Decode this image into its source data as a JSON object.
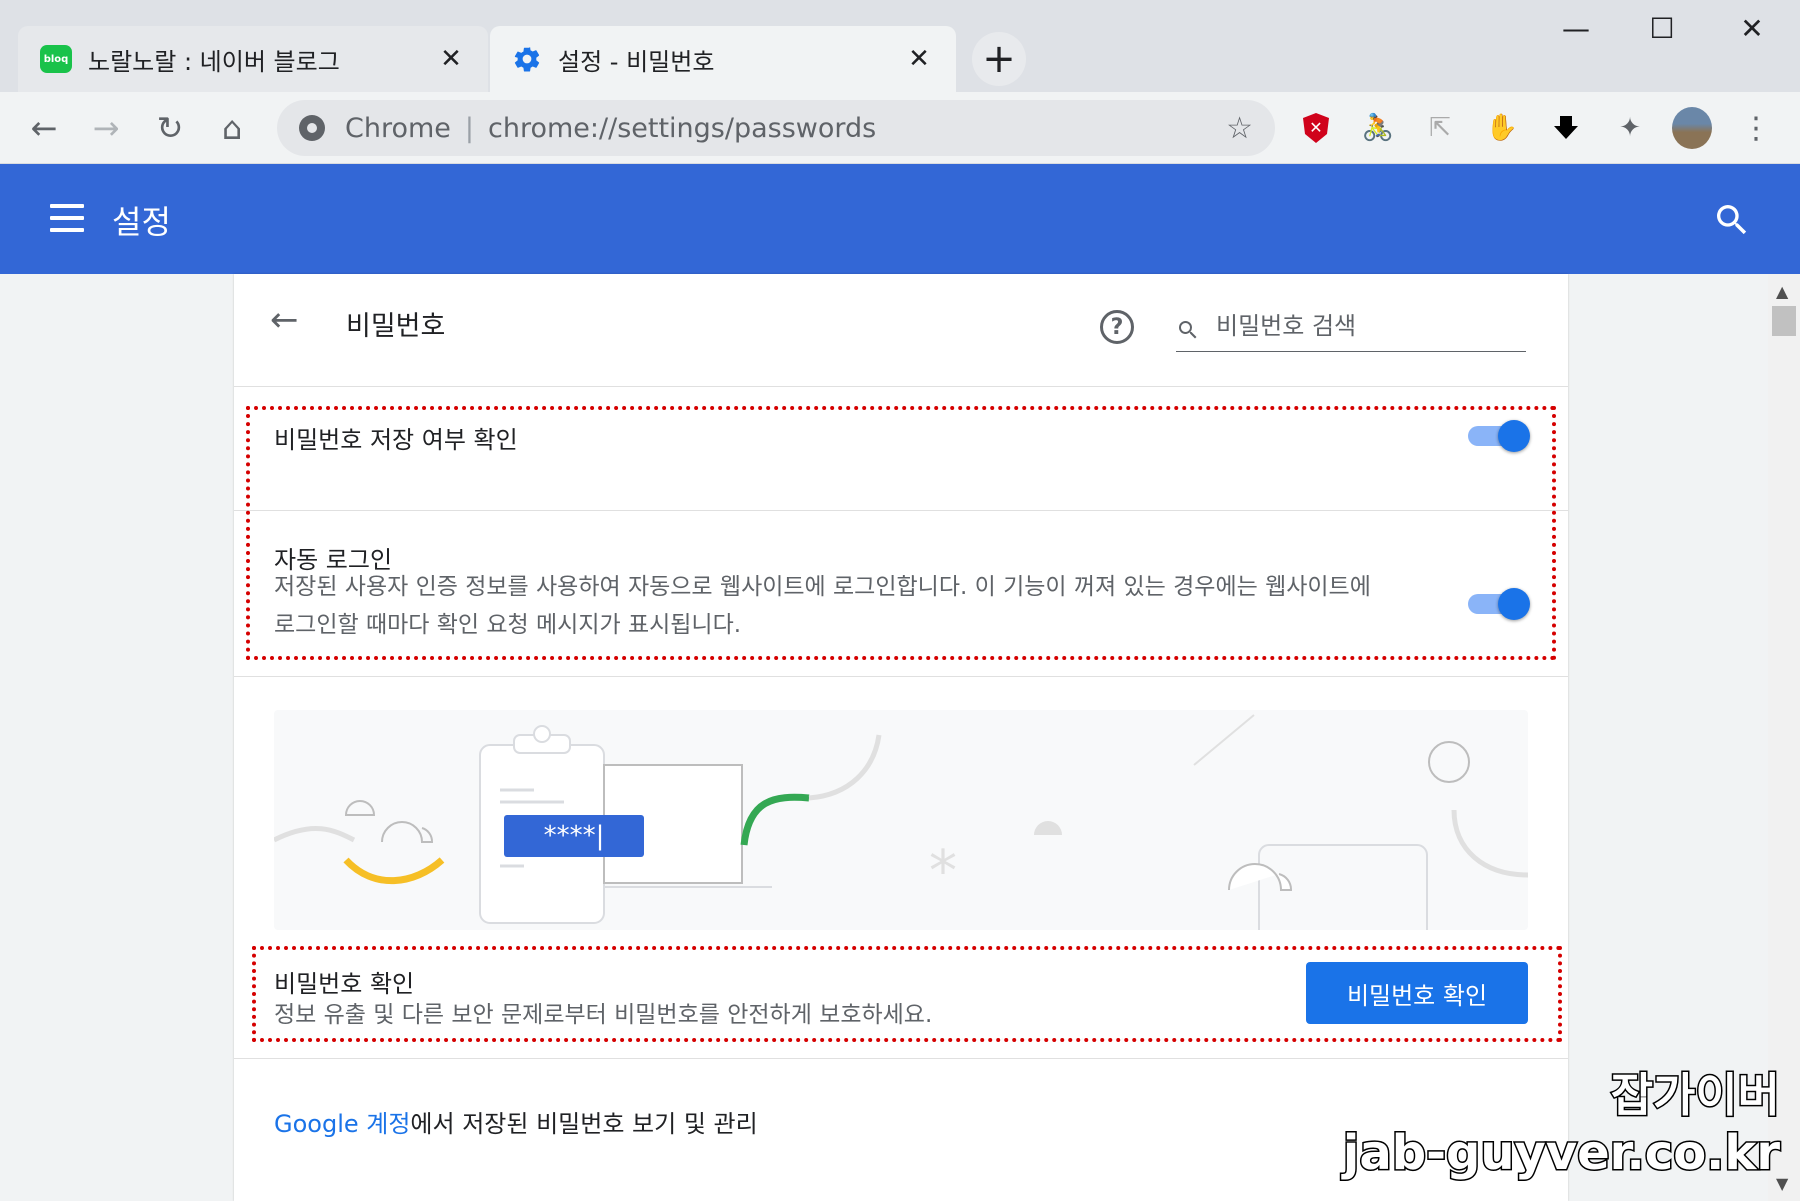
{
  "tabs": [
    {
      "title": "노랄노랄 : 네이버 블로그",
      "favicon": "bloq",
      "active": false
    },
    {
      "title": "설정 - 비밀번호",
      "favicon": "gear-icon",
      "active": true
    }
  ],
  "omnibox": {
    "chip": "Chrome",
    "separator": "|",
    "url": "chrome://settings/passwords"
  },
  "appbar": {
    "title": "설정"
  },
  "subpage": {
    "title": "비밀번호",
    "search_placeholder": "비밀번호 검색"
  },
  "settings": {
    "offer_save": {
      "title": "비밀번호 저장 여부 확인",
      "enabled": true
    },
    "auto_signin": {
      "title": "자동 로그인",
      "description": "저장된 사용자 인증 정보를 사용하여 자동으로 웹사이트에 로그인합니다. 이 기능이 꺼져 있는 경우에는 웹사이트에 로그인할 때마다 확인 요청 메시지가 표시됩니다.",
      "enabled": true
    }
  },
  "illustration": {
    "password_mask": "****|"
  },
  "password_check": {
    "title": "비밀번호 확인",
    "description": "정보 유출 및 다른 보안 문제로부터 비밀번호를 안전하게 보호하세요.",
    "button": "비밀번호 확인"
  },
  "footer": {
    "link": "Google 계정",
    "text": "에서 저장된 비밀번호 보기 및 관리"
  },
  "watermark": {
    "line1": "잡가이버",
    "line2": "jab-guyver.co.kr"
  },
  "colors": {
    "appbar": "#3367d6",
    "accent": "#1a73e8",
    "highlight_border": "#d50000"
  }
}
